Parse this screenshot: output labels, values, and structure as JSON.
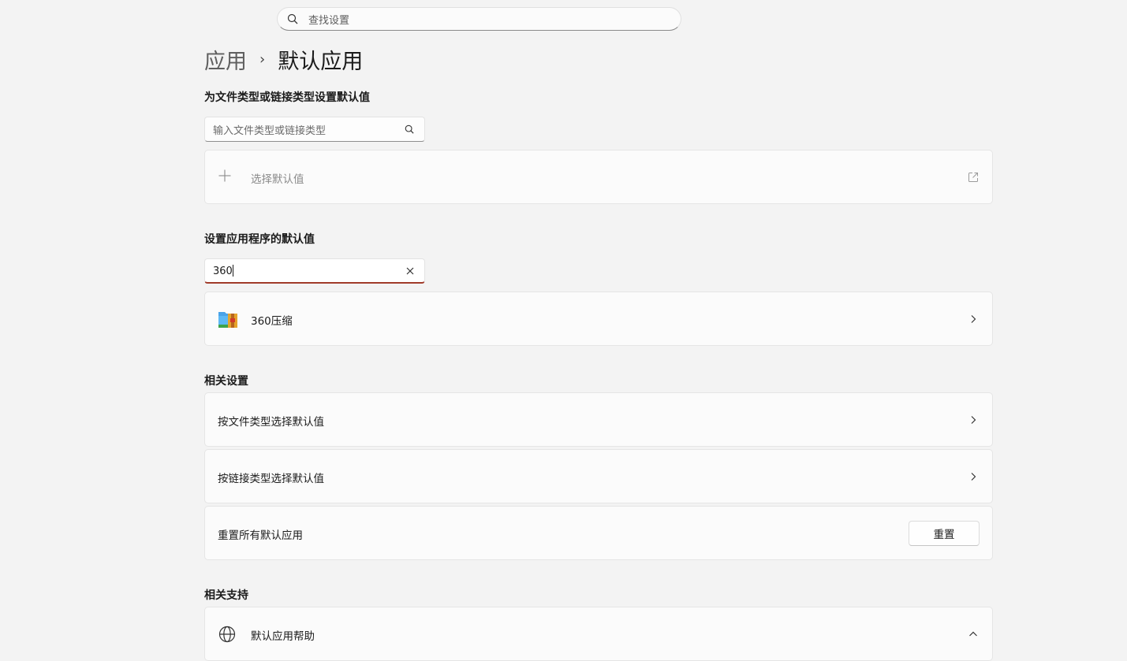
{
  "search": {
    "placeholder": "查找设置"
  },
  "breadcrumb": {
    "parent": "应用",
    "separator": "›",
    "current": "默认应用"
  },
  "file_types_section": {
    "title": "为文件类型或链接类型设置默认值",
    "input_placeholder": "输入文件类型或链接类型",
    "choose_default_label": "选择默认值"
  },
  "apps_section": {
    "title": "设置应用程序的默认值",
    "input_value": "360",
    "results": [
      {
        "name": "360压缩",
        "icon": "360-zip-app-icon"
      }
    ]
  },
  "related_settings": {
    "title": "相关设置",
    "items": [
      {
        "label": "按文件类型选择默认值"
      },
      {
        "label": "按链接类型选择默认值"
      },
      {
        "label": "重置所有默认应用",
        "button": "重置"
      }
    ]
  },
  "related_support": {
    "title": "相关支持",
    "items": [
      {
        "label": "默认应用帮助",
        "icon": "globe-icon"
      }
    ]
  },
  "colors": {
    "accent_underline": "#a03b2a",
    "background": "#f3f3f3",
    "card": "#fbfbfb"
  }
}
